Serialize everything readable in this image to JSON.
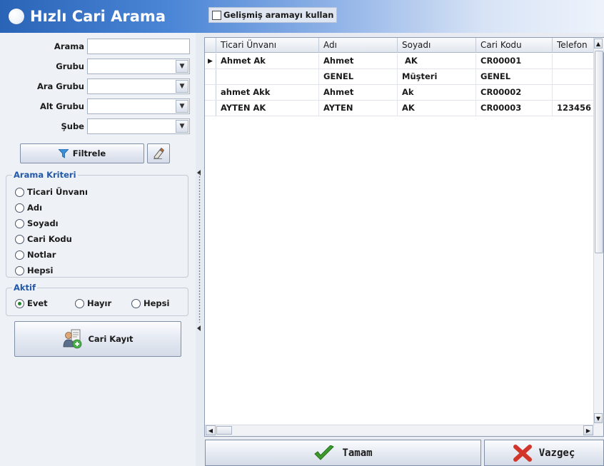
{
  "header": {
    "title": "Hızlı Cari Arama",
    "advanced_search_label": "Gelişmiş aramayı kullan"
  },
  "filters": {
    "arama_label": "Arama",
    "arama_value": "",
    "grubu_label": "Grubu",
    "ara_grubu_label": "Ara Grubu",
    "alt_grubu_label": "Alt Grubu",
    "sube_label": "Şube",
    "filter_button": "Filtrele"
  },
  "search_criteria": {
    "title": "Arama Kriteri",
    "options": [
      "Ticari Ünvanı",
      "Adı",
      "Soyadı",
      "Cari Kodu",
      "Notlar",
      "Hepsi"
    ]
  },
  "active": {
    "title": "Aktif",
    "options": [
      "Evet",
      "Hayır",
      "Hepsi"
    ],
    "selected": "Evet"
  },
  "cari_kayit_button": "Cari Kayıt",
  "grid": {
    "columns": [
      "Ticari Ünvanı",
      "Adı",
      "Soyadı",
      "Cari Kodu",
      "Telefon"
    ],
    "rows": [
      {
        "ticari": "Ahmet Ak",
        "adi": "Ahmet",
        "soyadi": " AK",
        "kod": "CR00001",
        "tel": ""
      },
      {
        "ticari": "",
        "adi": "GENEL",
        "soyadi": "Müşteri",
        "kod": "GENEL",
        "tel": ""
      },
      {
        "ticari": "ahmet Akk",
        "adi": "Ahmet",
        "soyadi": "Ak",
        "kod": "CR00002",
        "tel": ""
      },
      {
        "ticari": "AYTEN AK",
        "adi": "AYTEN",
        "soyadi": "AK",
        "kod": "CR00003",
        "tel": "123456"
      }
    ]
  },
  "buttons": {
    "ok": "Tamam",
    "cancel": "Vazgeç"
  },
  "colors": {
    "header_blue": "#2a64b7",
    "group_title": "#2458a8",
    "ok_green": "#3c9a2e",
    "cancel_red": "#d2362a"
  }
}
